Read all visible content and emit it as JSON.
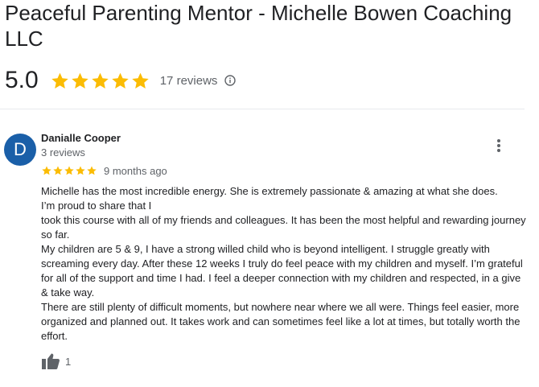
{
  "business": {
    "name": "Peaceful Parenting Mentor - Michelle Bowen Coaching LLC",
    "rating": "5.0",
    "stars": 5,
    "review_count_label": "17 reviews"
  },
  "review": {
    "avatar_letter": "D",
    "avatar_color": "#1a5fa8",
    "author": "Danialle Cooper",
    "author_meta": "3 reviews",
    "stars": 5,
    "time": "9 months ago",
    "text": "Michelle has the most incredible energy. She is extremely passionate & amazing at what she does.\nI’m proud to share that I\ntook this course with all of my friends and colleagues. It has been the most helpful and rewarding journey so far.\nMy children are 5 & 9, I have a strong willed child who is beyond intelligent.  I struggle greatly with screaming every day. After these 12 weeks I truly do feel peace with my children and myself. I’m grateful for all of the support and time I had. I feel a deeper connection with my children and respected, in a give & take way.\nThere are still plenty of difficult moments, but nowhere near where we all were. Things feel easier, more organized and planned out.  It takes work and can sometimes feel like a lot at times, but totally worth the effort.",
    "likes": "1"
  },
  "colors": {
    "star": "#fbbc04",
    "muted_text": "#5f6368",
    "icon": "#5f6368"
  },
  "icons": {
    "info": "info-icon",
    "more": "more-vert-icon",
    "like": "thumb-up-icon",
    "star": "star-icon"
  }
}
